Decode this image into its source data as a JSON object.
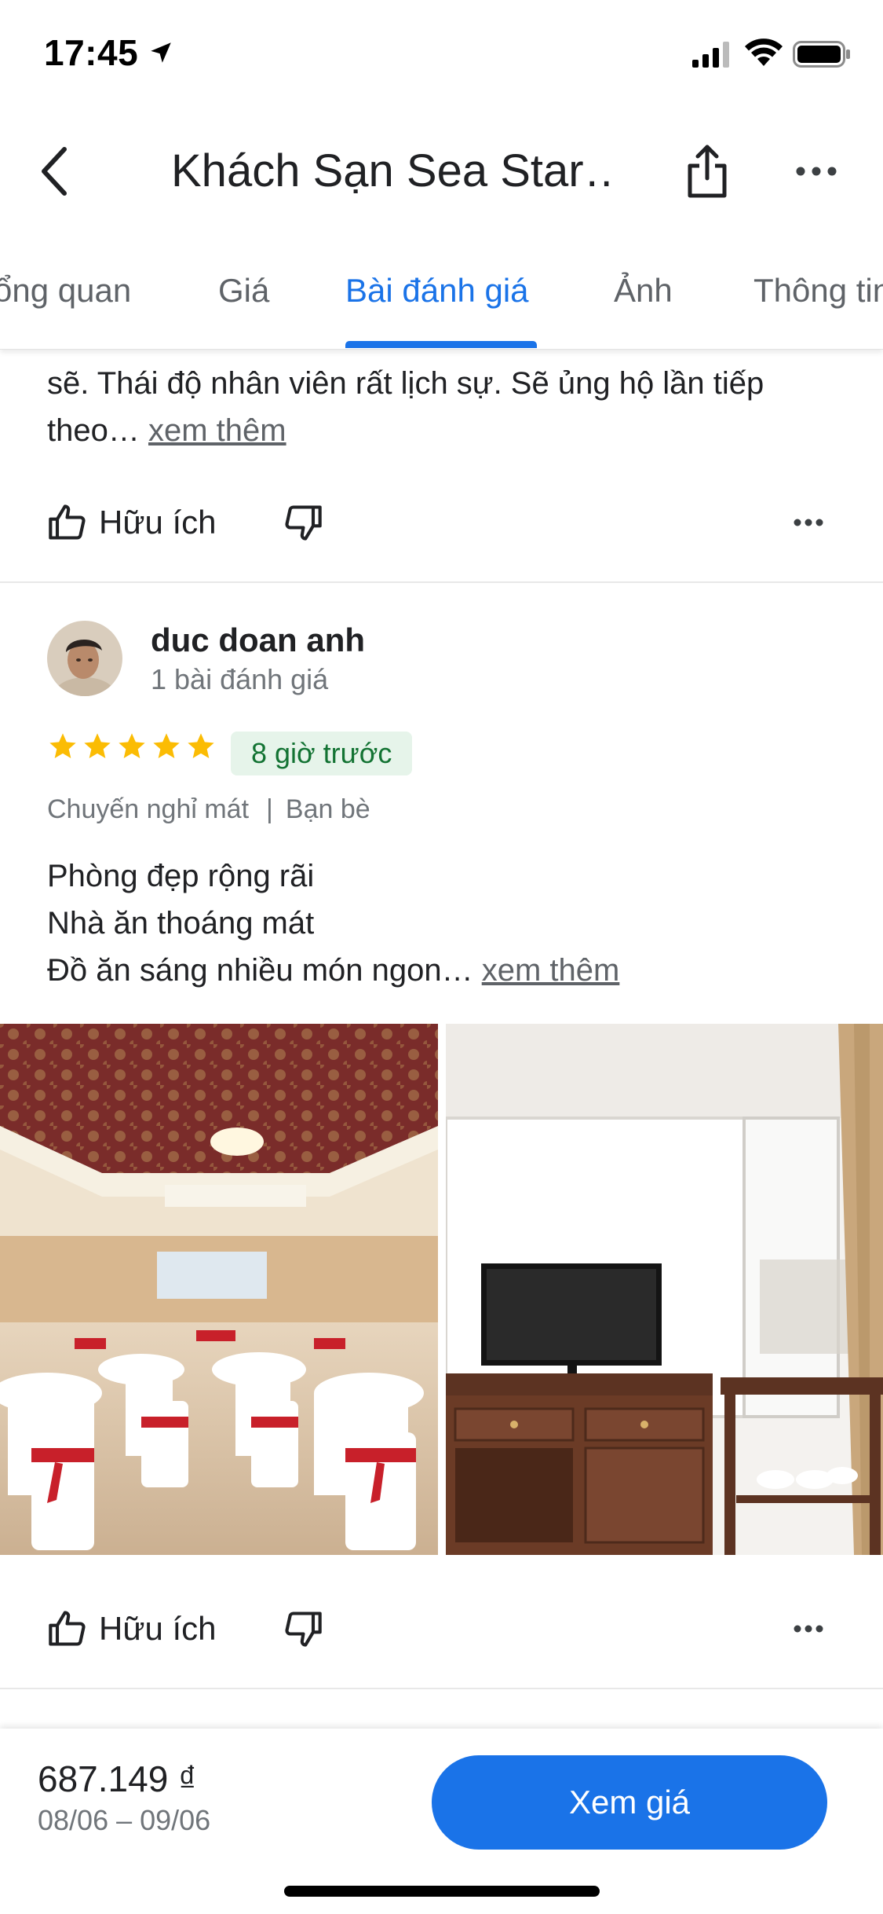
{
  "status_bar": {
    "time": "17:45"
  },
  "header": {
    "title": "Khách Sạn Sea Star…"
  },
  "tabs": [
    {
      "label": "ổng quan"
    },
    {
      "label": "Giá"
    },
    {
      "label": "Bài đánh giá"
    },
    {
      "label": "Ảnh"
    },
    {
      "label": "Thông tin"
    }
  ],
  "active_tab": "Bài đánh giá",
  "previous_review": {
    "text_line1": "sẽ. Thái độ nhân viên rất lịch sự. Sẽ ủng hộ lần tiếp",
    "text_line2_prefix": "theo…",
    "more_label": "xem thêm",
    "helpful_label": "Hữu ích"
  },
  "review": {
    "reviewer_name": "duc doan anh",
    "reviewer_count": "1 bài đánh giá",
    "rating": 5,
    "time_ago": "8 giờ trước",
    "trip_type": "Chuyến nghỉ mát",
    "companion": "Bạn bè",
    "text_lines": [
      "Phòng đẹp rộng rãi",
      "Nhà ăn thoáng mát"
    ],
    "text_last_prefix": "Đồ ăn sáng nhiều món ngon…",
    "more_label": "xem thêm",
    "helpful_label": "Hữu ích"
  },
  "bottom_bar": {
    "price": "687.149 ₫",
    "dates": "08/06 – 09/06",
    "cta_label": "Xem giá"
  },
  "colors": {
    "accent": "#1a73e8",
    "star": "#fbbc04",
    "badge_bg": "#e6f4ea",
    "badge_text": "#137333"
  }
}
